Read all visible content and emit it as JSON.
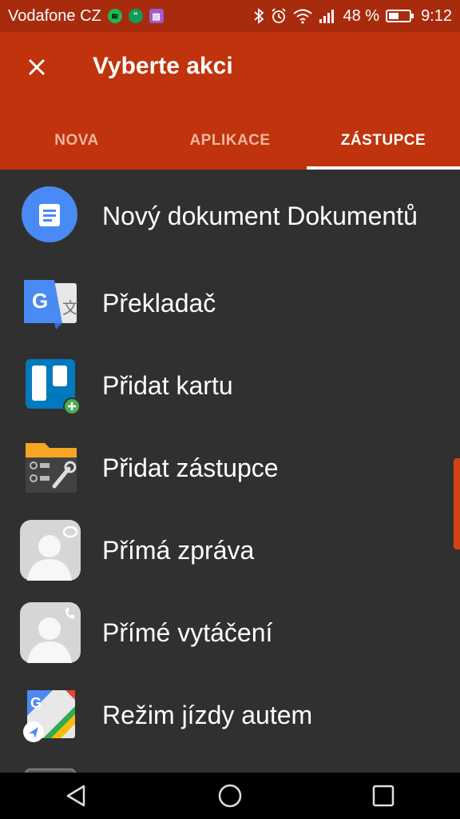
{
  "status_bar": {
    "carrier": "Vodafone CZ",
    "battery_percent": "48 %",
    "time": "9:12"
  },
  "header": {
    "title": "Vyberte akci"
  },
  "tabs": [
    {
      "label": "NOVA",
      "active": false
    },
    {
      "label": "APLIKACE",
      "active": false
    },
    {
      "label": "ZÁSTUPCE",
      "active": true
    }
  ],
  "items": [
    {
      "label": "Nový dokument Dokumentů",
      "icon": "docs-icon"
    },
    {
      "label": "Překladač",
      "icon": "translate-icon"
    },
    {
      "label": "Přidat kartu",
      "icon": "trello-icon"
    },
    {
      "label": "Přidat zástupce",
      "icon": "file-manager-icon"
    },
    {
      "label": "Přímá zpráva",
      "icon": "contact-message-icon"
    },
    {
      "label": "Přímé vytáčení",
      "icon": "contact-phone-icon"
    },
    {
      "label": "Režim jízdy autem",
      "icon": "maps-icon"
    }
  ],
  "colors": {
    "status_bar": "#a82b0e",
    "toolbar": "#c0330c",
    "list_background": "#303030",
    "accent": "#d44215"
  }
}
